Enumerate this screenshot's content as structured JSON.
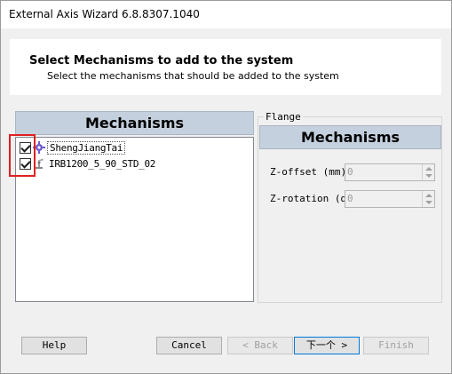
{
  "window": {
    "title": "External Axis Wizard 6.8.8307.1040"
  },
  "header": {
    "title": "Select Mechanisms to add to the system",
    "subtitle": "Select the mechanisms that should be added to the system"
  },
  "mechanisms_panel": {
    "title": "Mechanisms",
    "items": [
      {
        "label": "ShengJiangTai",
        "checked": true,
        "icon": "mechanism-gear-icon"
      },
      {
        "label": "IRB1200_5_90_STD_02",
        "checked": true,
        "icon": "robot-icon"
      }
    ]
  },
  "flange": {
    "legend": "Flange",
    "title": "Mechanisms",
    "fields": [
      {
        "label": "Z-offset (mm)",
        "value": "0"
      },
      {
        "label": "Z-rotation (deg)",
        "value": "0"
      }
    ]
  },
  "buttons": {
    "help": "Help",
    "cancel": "Cancel",
    "back": "< Back",
    "next": "下一个 >",
    "finish": "Finish"
  },
  "colors": {
    "panel_header_bg": "#c5d0de",
    "highlight": "#e02020"
  }
}
